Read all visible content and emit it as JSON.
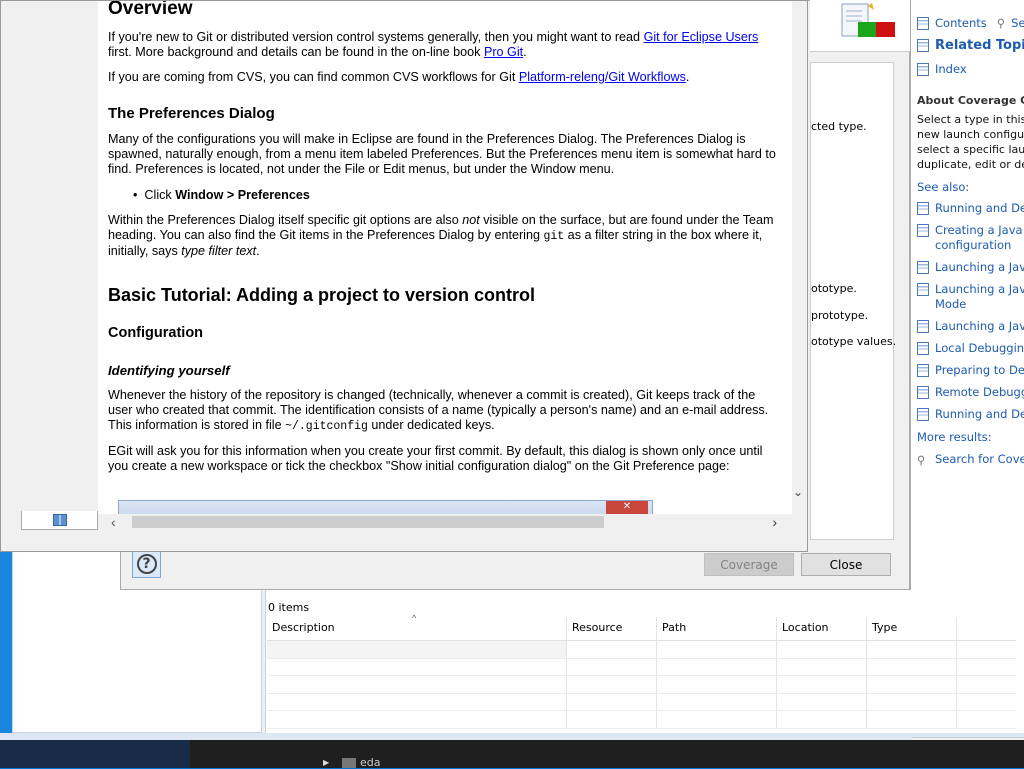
{
  "help_doc": {
    "overview_heading": "Overview",
    "p1_a": "If you're new to Git or distributed version control systems generally, then you might want to read ",
    "p1_link1": "Git for Eclipse Users",
    "p1_b": " first. More background and details can be found in the on-line book ",
    "p1_link2": "Pro Git",
    "p1_c": ".",
    "p2_a": "If you are coming from CVS, you can find common CVS workflows for Git ",
    "p2_link": "Platform-releng/Git Workflows",
    "p2_b": ".",
    "prefs_heading": "The Preferences Dialog",
    "p3": "Many of the configurations you will make in Eclipse are found in the Preferences Dialog. The Preferences Dialog is spawned, naturally enough, from a menu item labeled Preferences. But the Preferences menu item is somewhat hard to find. Preferences is located, not under the File or Edit menus, but under the Window menu.",
    "bullet_a": "Click ",
    "bullet_b": "Window > Preferences",
    "p4_a": "Within the Preferences Dialog itself specific git options are also ",
    "p4_not": "not",
    "p4_b": " visible on the surface, but are found under the Team heading. You can also find the Git items in the Preferences Dialog by entering ",
    "p4_code": "git",
    "p4_c": " as a filter string in the box where it, initially, says ",
    "p4_em": "type filter text",
    "p4_d": ".",
    "tutorial_heading": "Basic Tutorial: Adding a project to version control",
    "config_heading": "Configuration",
    "identify_heading": "Identifying yourself",
    "p5_a": "Whenever the history of the repository is changed (technically, whenever a commit is created), Git keeps track of the user who created that commit. The identification consists of a name (typically a person's name) and an e-mail address. This information is stored in file ",
    "p5_code": "~/.gitconfig",
    "p5_b": " under dedicated keys.",
    "p6": "EGit will ask you for this information when you create your first commit. By default, this dialog is shown only once until you create a new workspace or tick the checkbox \"Show initial configuration dialog\" on the Git Preference page:"
  },
  "dialog": {
    "frag1": "cted type.",
    "frag2": "ototype.",
    "frag3": "prototype.",
    "frag4": "ototype values.",
    "coverage_button": "Coverage",
    "close_button": "Close"
  },
  "help_panel": {
    "contents": "Contents",
    "search_short": "Se",
    "related_topics": "Related Topics",
    "index": "Index",
    "about": "About Coverage Co",
    "desc_lines": [
      "Select a type in this t",
      "new launch configu",
      "select a specific laun",
      "duplicate, edit or del"
    ],
    "see_also": "See also:",
    "links": [
      [
        "Running and De"
      ],
      [
        "Creating a Java a",
        "configuration"
      ],
      [
        "Launching a Java"
      ],
      [
        "Launching a Java",
        "Mode"
      ],
      [
        "Launching a Java"
      ],
      [
        "Local Debugging"
      ],
      [
        "Preparing to Deb"
      ],
      [
        "Remote Debugg"
      ],
      [
        "Running and De"
      ]
    ],
    "more_results": "More results:",
    "search_for": "Search for Cover"
  },
  "problems": {
    "count": "0 items",
    "columns": [
      "Description",
      "Resource",
      "Path",
      "Location",
      "Type",
      ""
    ]
  },
  "taskbar": {
    "label": "eda"
  },
  "colors": {
    "desktop": "#0078d7",
    "link": "#0000ee",
    "help_link": "#1d5bb1"
  }
}
